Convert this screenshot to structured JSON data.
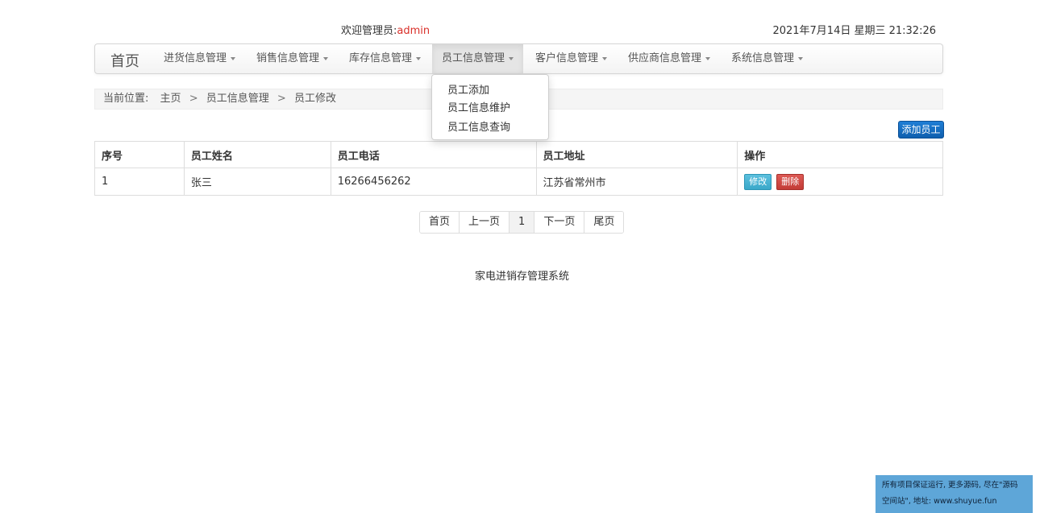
{
  "header": {
    "welcome_prefix": "欢迎管理员:",
    "username": "admin",
    "datetime": "2021年7月14日 星期三 21:32:26"
  },
  "navbar": {
    "brand": "首页",
    "items": [
      {
        "label": "进货信息管理"
      },
      {
        "label": "销售信息管理"
      },
      {
        "label": "库存信息管理"
      },
      {
        "label": "员工信息管理"
      },
      {
        "label": "客户信息管理"
      },
      {
        "label": "供应商信息管理"
      },
      {
        "label": "系统信息管理"
      }
    ]
  },
  "dropdown": {
    "items": [
      {
        "label": "员工添加"
      },
      {
        "label": "员工信息维护"
      },
      {
        "label": "员工信息查询"
      }
    ]
  },
  "breadcrumb": {
    "label": "当前位置:",
    "items": [
      "主页",
      "员工信息管理",
      "员工修改"
    ],
    "separator": ">"
  },
  "toolbar": {
    "add_label": "添加员工"
  },
  "table": {
    "headers": [
      "序号",
      "员工姓名",
      "员工电话",
      "员工地址",
      "操作"
    ],
    "rows": [
      {
        "id": "1",
        "name": "张三",
        "phone": "16266456262",
        "address": "江苏省常州市"
      }
    ],
    "edit_label": "修改",
    "delete_label": "删除"
  },
  "pagination": {
    "first": "首页",
    "prev": "上一页",
    "current": "1",
    "next": "下一页",
    "last": "尾页"
  },
  "footer": {
    "text": "家电进销存管理系统"
  },
  "notice": {
    "line1": "所有项目保证运行, 更多源码, 尽在\"源码",
    "line2": "空间站\", 地址: www.shuyue.fun"
  },
  "colors": {
    "accent": "#0f5fae",
    "username": "#d9302a",
    "edit": "#5bc0de",
    "delete": "#d9534f",
    "notice_bg": "#5ea6d8"
  }
}
